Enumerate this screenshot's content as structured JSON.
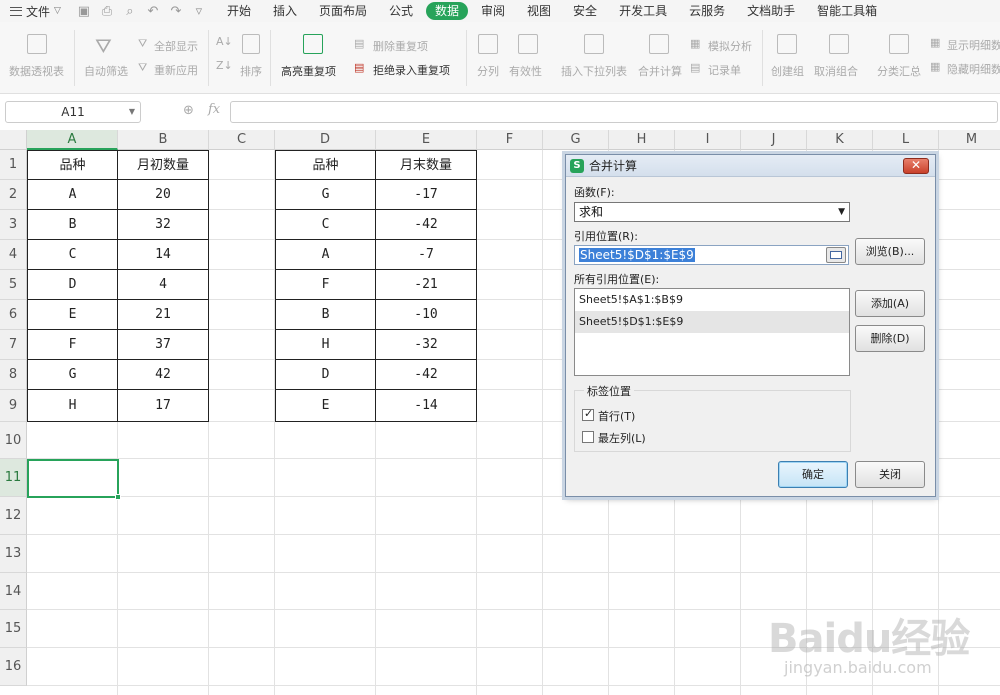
{
  "menubar": {
    "file_label": "文件",
    "tabs": [
      {
        "label": "开始"
      },
      {
        "label": "插入"
      },
      {
        "label": "页面布局"
      },
      {
        "label": "公式"
      },
      {
        "label": "数据",
        "active": true
      },
      {
        "label": "审阅"
      },
      {
        "label": "视图"
      },
      {
        "label": "安全"
      },
      {
        "label": "开发工具"
      },
      {
        "label": "云服务"
      },
      {
        "label": "文档助手"
      },
      {
        "label": "智能工具箱"
      }
    ]
  },
  "ribbon": {
    "pivot": "数据透视表",
    "auto_filter": "自动筛选",
    "show_all": "全部显示",
    "reapply": "重新应用",
    "sort": "排序",
    "highlight_dup": "高亮重复项",
    "delete_dup": "删除重复项",
    "reject_dup": "拒绝录入重复项",
    "split_col": "分列",
    "validity": "有效性",
    "insert_dropdown": "插入下拉列表",
    "consolidate": "合并计算",
    "what_if": "模拟分析",
    "record_sheet": "记录单",
    "create_group": "创建组",
    "ungroup": "取消组合",
    "subtotal": "分类汇总",
    "show_detail": "显示明细数据",
    "hide_detail": "隐藏明细数据"
  },
  "formula_bar": {
    "name_box": "A11",
    "fx": "fx"
  },
  "columns": [
    "A",
    "B",
    "C",
    "D",
    "E",
    "F",
    "G",
    "H",
    "I",
    "J",
    "K",
    "L",
    "M"
  ],
  "rows": [
    "1",
    "2",
    "3",
    "4",
    "5",
    "6",
    "7",
    "8",
    "9",
    "10",
    "11",
    "12",
    "13",
    "14",
    "15",
    "16"
  ],
  "table1": {
    "headers": [
      "品种",
      "月初数量"
    ],
    "rows": [
      [
        "A",
        "20"
      ],
      [
        "B",
        "32"
      ],
      [
        "C",
        "14"
      ],
      [
        "D",
        "4"
      ],
      [
        "E",
        "21"
      ],
      [
        "F",
        "37"
      ],
      [
        "G",
        "42"
      ],
      [
        "H",
        "17"
      ]
    ]
  },
  "table2": {
    "headers": [
      "品种",
      "月末数量"
    ],
    "rows": [
      [
        "G",
        "-17"
      ],
      [
        "C",
        "-42"
      ],
      [
        "A",
        "-7"
      ],
      [
        "F",
        "-21"
      ],
      [
        "B",
        "-10"
      ],
      [
        "H",
        "-32"
      ],
      [
        "D",
        "-42"
      ],
      [
        "E",
        "-14"
      ]
    ]
  },
  "dialog": {
    "title": "合并计算",
    "function_label": "函数(F):",
    "function_value": "求和",
    "ref_label": "引用位置(R):",
    "ref_value": "Sheet5!$D$1:$E$9",
    "browse": "浏览(B)...",
    "all_refs_label": "所有引用位置(E):",
    "all_refs": [
      "Sheet5!$A$1:$B$9",
      "Sheet5!$D$1:$E$9"
    ],
    "add": "添加(A)",
    "delete": "删除(D)",
    "label_group": "标签位置",
    "top_row": "首行(T)",
    "top_row_checked": true,
    "left_col": "最左列(L)",
    "left_col_checked": false,
    "ok": "确定",
    "close": "关闭"
  },
  "watermark": {
    "main": "Baidu经验",
    "sub": "jingyan.baidu.com"
  }
}
